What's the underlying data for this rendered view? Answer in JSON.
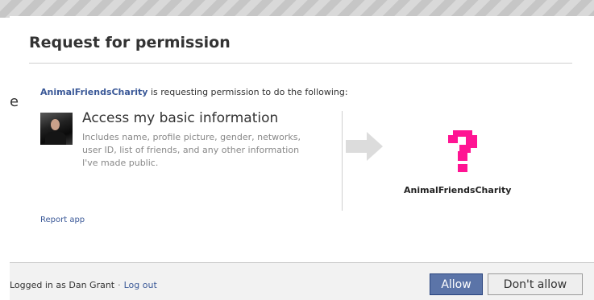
{
  "dialog": {
    "title": "Request for permission",
    "intro": {
      "app_name": "AnimalFriendsCharity",
      "text": " is requesting permission to do the following:"
    },
    "permission": {
      "title": "Access my basic information",
      "description": "Includes name, profile picture, gender, networks, user ID, list of friends, and any other information I've made public."
    },
    "app_label": "AnimalFriendsCharity",
    "report_link": "Report app",
    "background_peek": "e"
  },
  "footer": {
    "logged_in_text": "Logged in as Dan Grant",
    "separator": "·",
    "logout_link": "Log out",
    "allow_label": "Allow",
    "deny_label": "Don't allow"
  },
  "colors": {
    "link": "#3b5998",
    "allow_button": "#5b74a8",
    "app_icon": "#ff1493"
  },
  "icons": {
    "app_icon": "question-mark-icon",
    "arrow": "arrow-right-icon"
  }
}
